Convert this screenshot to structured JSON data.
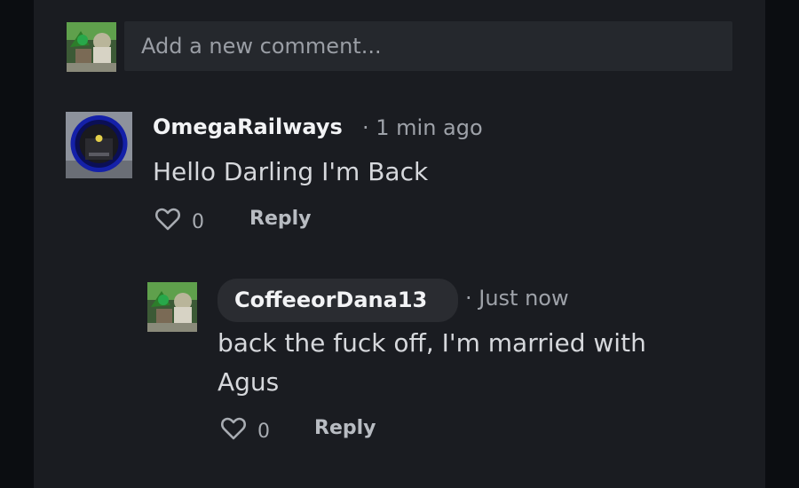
{
  "new_comment": {
    "placeholder": "Add a new comment..."
  },
  "comments": [
    {
      "author": "OmegaRailways",
      "time": "· 1 min ago",
      "text": "Hello Darling I'm Back",
      "likes": "0",
      "reply_label": "Reply",
      "replies": [
        {
          "author": "CoffeeorDana13",
          "time": "· Just now",
          "text_line1": "back the fuck off, I'm married with",
          "text_line2": "Agus",
          "likes": "0",
          "reply_label": "Reply"
        }
      ]
    }
  ],
  "colors": {
    "background": "#0b0d11",
    "panel": "#1a1c21",
    "input": "#25282d",
    "author_pill": "#2a2c31",
    "muted_text": "#9ea2a9"
  },
  "icons": [
    "heart-outline-icon"
  ]
}
